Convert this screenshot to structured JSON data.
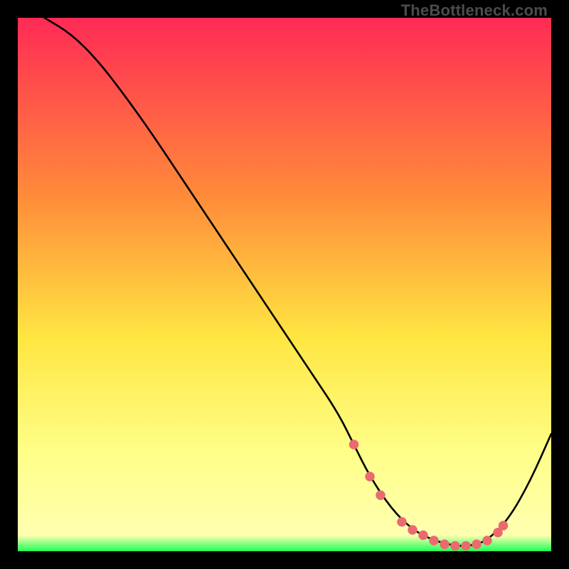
{
  "watermark": "TheBottleneck.com",
  "colors": {
    "gradient_top": "#ff2a55",
    "gradient_mid_upper": "#ff8a3a",
    "gradient_mid": "#ffe642",
    "gradient_lower": "#ffff8a",
    "gradient_bottom": "#1eff57",
    "curve": "#000000",
    "marker": "#ea6a70",
    "background": "#000000"
  },
  "chart_data": {
    "type": "line",
    "title": "",
    "xlabel": "",
    "ylabel": "",
    "xlim": [
      0,
      100
    ],
    "ylim": [
      0,
      100
    ],
    "grid": false,
    "legend": false,
    "series": [
      {
        "name": "bottleneck-curve",
        "x": [
          5,
          10,
          15,
          20,
          25,
          30,
          35,
          40,
          45,
          50,
          55,
          60,
          63,
          66,
          70,
          74,
          78,
          82,
          85,
          88,
          92,
          96,
          100
        ],
        "y": [
          100,
          97,
          92,
          85.5,
          78.5,
          71,
          63.5,
          56,
          48.5,
          41,
          33.5,
          26,
          20,
          14,
          8,
          4,
          2,
          1,
          1,
          2,
          6,
          13,
          22
        ]
      }
    ],
    "markers": {
      "name": "highlight-points",
      "x": [
        63,
        66,
        68,
        72,
        74,
        76,
        78,
        80,
        82,
        84,
        86,
        88,
        90,
        91
      ],
      "y": [
        20,
        14,
        10.5,
        5.5,
        4,
        3,
        2,
        1.3,
        1,
        1,
        1.3,
        2,
        3.5,
        4.8
      ]
    }
  }
}
